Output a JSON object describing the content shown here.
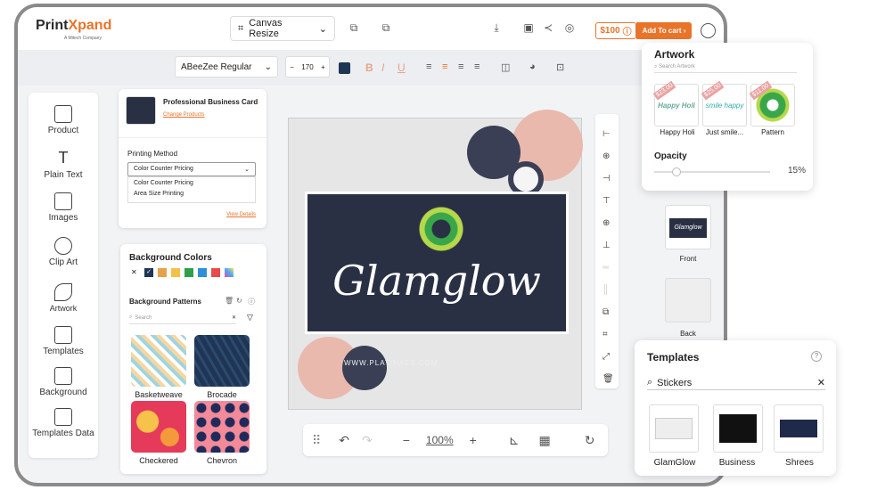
{
  "brand": {
    "name_a": "Print",
    "name_b": "Xpand",
    "tagline": "A Mitech Company"
  },
  "topbar": {
    "doc_mode": "Canvas Resize",
    "price": "$100",
    "cart_label": "Add To cart"
  },
  "fontbar": {
    "font": "ABeeZee Regular",
    "size": "170",
    "text_color": "#1f3553"
  },
  "sidebar": {
    "items": [
      {
        "label": "Product",
        "icon": "cube-icon"
      },
      {
        "label": "Plain Text",
        "icon": "text-icon"
      },
      {
        "label": "Images",
        "icon": "image-icon"
      },
      {
        "label": "Clip Art",
        "icon": "smiley-icon"
      },
      {
        "label": "Artwork",
        "icon": "brush-icon"
      },
      {
        "label": "Templates",
        "icon": "templates-icon"
      },
      {
        "label": "Background",
        "icon": "background-icon"
      },
      {
        "label": "Templates Data",
        "icon": "data-icon"
      }
    ]
  },
  "product": {
    "name": "Professional Business Card",
    "change": "Change Products",
    "method_title": "Printing Method",
    "selected": "Color Counter Pricing",
    "options": [
      "Color Counter Pricing",
      "Area Size Printing"
    ],
    "details": "View Details"
  },
  "background": {
    "title": "Background Colors",
    "colors": [
      "#1f3553",
      "#e8a04a",
      "#f2c14a",
      "#2ea04a",
      "#2e8fd8",
      "#e84a4a"
    ],
    "patterns_title": "Background Patterns",
    "search_placeholder": "Search",
    "patterns": [
      "Basketweave",
      "Brocade",
      "Checkered",
      "Chevron"
    ]
  },
  "canvas": {
    "title": "Glamglow",
    "url": "WWW.PLATINAZS.COM"
  },
  "bottom": {
    "zoom": "100%"
  },
  "artwork": {
    "title": "Artwork",
    "search_placeholder": "Search Artwork",
    "items": [
      {
        "label": "Happy Holi",
        "price": "$23.00",
        "art": "Happy Holi"
      },
      {
        "label": "Just smile...",
        "price": "$25.00",
        "art": "smile happy"
      },
      {
        "label": "Pattern",
        "price": "$11.00",
        "art": ""
      }
    ],
    "opacity_label": "Opacity",
    "opacity": "15%"
  },
  "sides": {
    "front": "Front",
    "back": "Back",
    "front_art": "Glamglow"
  },
  "templates": {
    "title": "Templates",
    "search": "Stickers",
    "items": [
      "GlamGlow",
      "Business",
      "Shrees"
    ]
  }
}
